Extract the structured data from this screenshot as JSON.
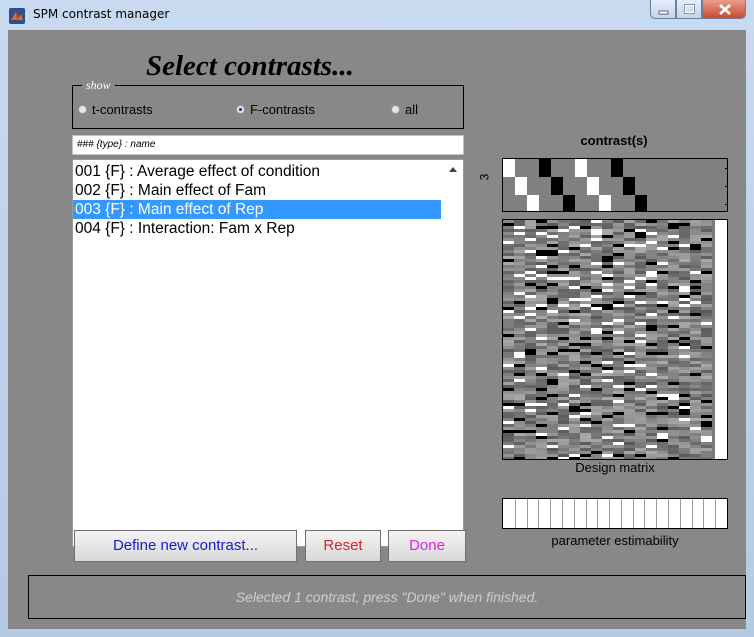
{
  "window": {
    "title": "SPM contrast manager"
  },
  "heading": "Select contrasts...",
  "show_group": {
    "label": "show",
    "options": [
      {
        "label": "t-contrasts",
        "selected": false
      },
      {
        "label": "F-contrasts",
        "selected": true
      },
      {
        "label": "all",
        "selected": false
      }
    ]
  },
  "list_header": "### {type} : name",
  "contrast_list": {
    "items": [
      {
        "label": "001 {F} : Average effect of condition",
        "selected": false
      },
      {
        "label": "002 {F} : Main effect of Fam",
        "selected": false
      },
      {
        "label": "003 {F} : Main effect of Rep",
        "selected": true
      },
      {
        "label": "004 {F} : Interaction: Fam x Rep",
        "selected": false
      }
    ]
  },
  "buttons": {
    "define": "Define new contrast...",
    "reset": "Reset",
    "done": "Done"
  },
  "button_colors": {
    "define": "#1a1acc",
    "reset": "#e02020",
    "done": "#e020e0"
  },
  "panel": {
    "contrast_title": "contrast(s)",
    "contrast_dim_label": "3",
    "design_caption": "Design matrix",
    "estimability_caption": "parameter estimability"
  },
  "status": "Selected 1 contrast, press \"Done\" when finished.",
  "colors": {
    "background": "#888888",
    "selection": "#3399ff",
    "status_text": "#cfcfcf"
  }
}
